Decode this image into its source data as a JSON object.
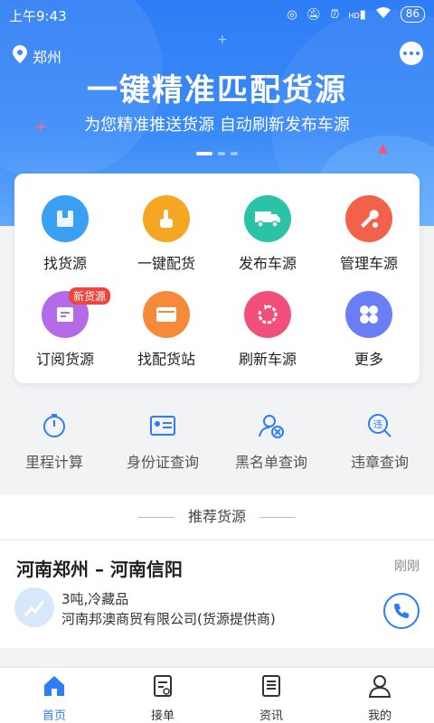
{
  "status": {
    "time": "上午9:43",
    "signal_label": "HD",
    "battery": "86"
  },
  "location": {
    "city": "郑州"
  },
  "banner": {
    "headline": "一键精准匹配货源",
    "subline": "为您精准推送货源 自动刷新发布车源"
  },
  "grid": {
    "items": [
      {
        "label": "找货源",
        "icon": "box-icon",
        "color": "#3aa0f3"
      },
      {
        "label": "一键配货",
        "icon": "tap-icon",
        "color": "#f5a623"
      },
      {
        "label": "发布车源",
        "icon": "truck-icon",
        "color": "#2ac3a5"
      },
      {
        "label": "管理车源",
        "icon": "wrench-icon",
        "color": "#f2624a"
      },
      {
        "label": "订阅货源",
        "icon": "subscribe-icon",
        "color": "#b56ae8",
        "badge": "新货源"
      },
      {
        "label": "找配货站",
        "icon": "wallet-icon",
        "color": "#f58a3a"
      },
      {
        "label": "刷新车源",
        "icon": "refresh-icon",
        "color": "#f2507a"
      },
      {
        "label": "更多",
        "icon": "more-icon",
        "color": "#6a7ef5"
      }
    ]
  },
  "tools": {
    "items": [
      {
        "label": "里程计算",
        "icon": "timer-icon"
      },
      {
        "label": "身份证查询",
        "icon": "id-card-icon"
      },
      {
        "label": "黑名单查询",
        "icon": "blacklist-icon"
      },
      {
        "label": "违章查询",
        "icon": "violation-icon"
      }
    ]
  },
  "recommend": {
    "title": "推荐货源",
    "card": {
      "route": "河南郑州 – 河南信阳",
      "time_ago": "刚刚",
      "goods": "3吨,冷藏品",
      "company": "河南邦澳商贸有限公司(货源提供商)"
    }
  },
  "nav": {
    "items": [
      {
        "label": "首页",
        "active": true
      },
      {
        "label": "接单"
      },
      {
        "label": "资讯"
      },
      {
        "label": "我的"
      }
    ]
  },
  "colors": {
    "primary": "#2f7df6",
    "badge": "#f0453a"
  }
}
